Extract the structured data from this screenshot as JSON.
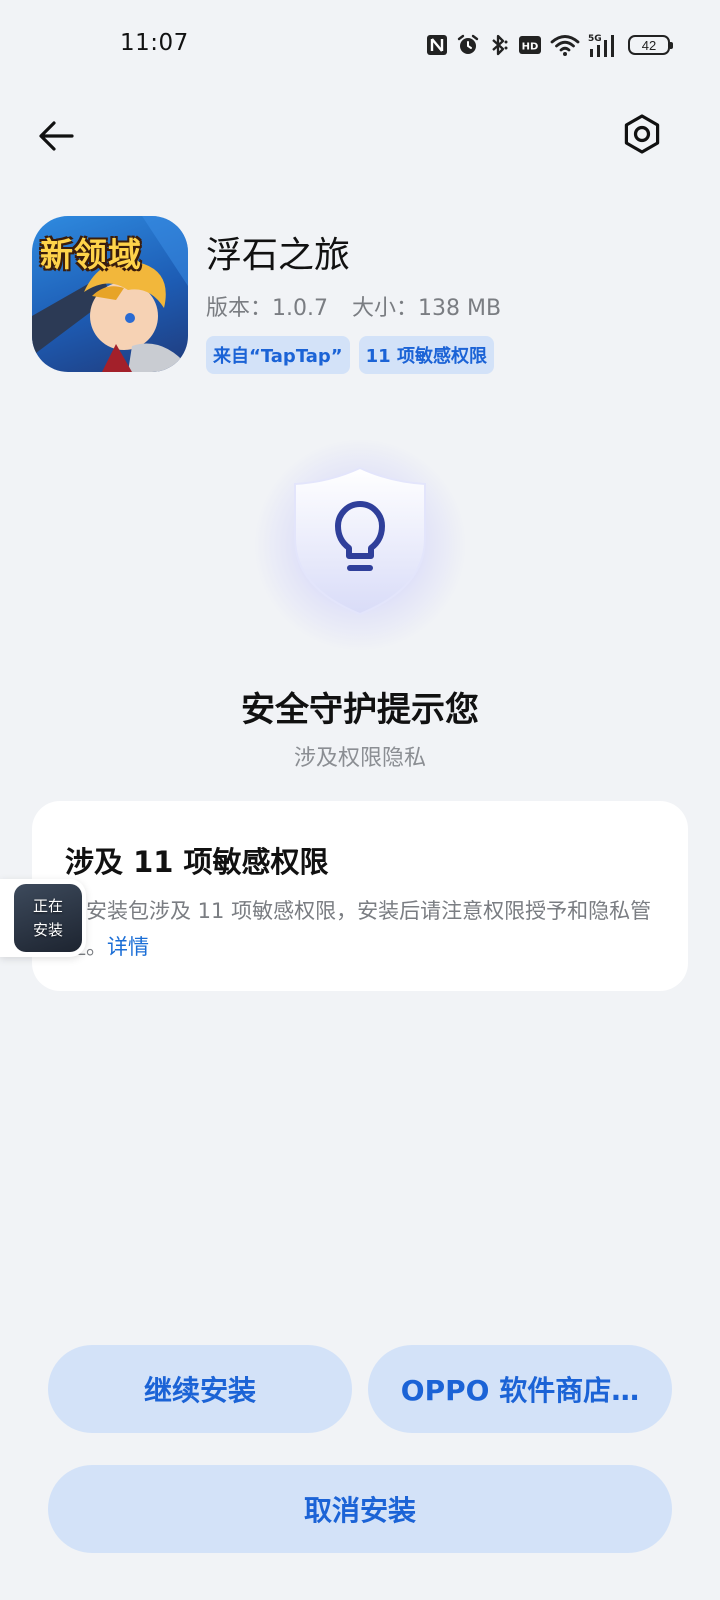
{
  "status_bar": {
    "time": "11:07",
    "battery": "42",
    "icons": [
      "nfc-icon",
      "alarm-icon",
      "bluetooth-icon",
      "hd-icon",
      "wifi-icon",
      "signal-5g-icon",
      "battery-icon"
    ]
  },
  "top_bar": {
    "back_icon": "arrow-left-icon",
    "settings_icon": "settings-hexagon-icon"
  },
  "app": {
    "name": "浮石之旅",
    "icon_text": "新领域",
    "version": "版本：1.0.7",
    "size": "大小：138 MB",
    "tags": [
      "来自“TapTap”",
      "11 项敏感权限"
    ]
  },
  "guard": {
    "icon": "lightbulb-shield-icon",
    "title": "安全守护提示您",
    "subtitle": "涉及权限隐私"
  },
  "card": {
    "title": "涉及 11 项敏感权限",
    "description": "该安装包涉及 11 项敏感权限，安装后请注意权限授予和隐私管控。",
    "link": "详情"
  },
  "floating": {
    "line1": "正在",
    "line2": "安装"
  },
  "buttons": {
    "continue": "继续安装",
    "store": "OPPO 软件商店…",
    "cancel": "取消安装"
  },
  "colors": {
    "background": "#f1f3f6",
    "accent": "#1b63d6",
    "button_bg": "#d3e2f8",
    "card_bg": "#ffffff"
  }
}
